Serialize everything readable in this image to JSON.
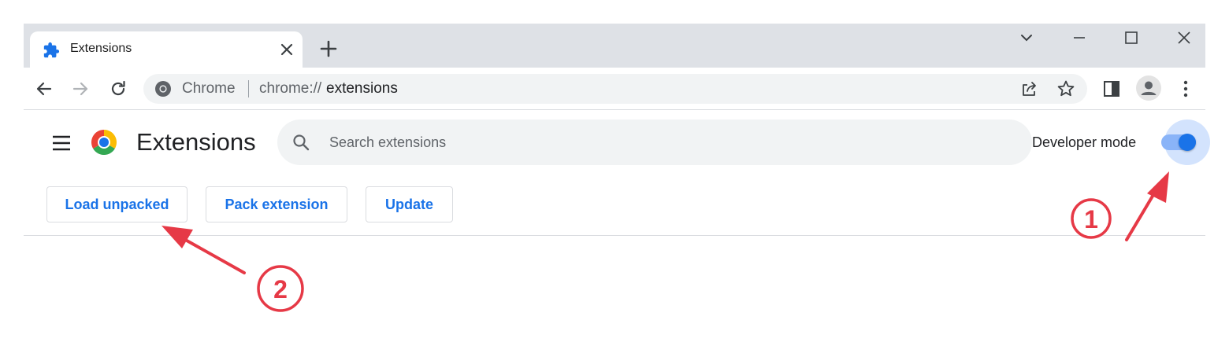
{
  "tab": {
    "title": "Extensions"
  },
  "omnibox": {
    "chip_label": "Chrome",
    "url_scheme": "chrome://",
    "url_path": "extensions"
  },
  "page": {
    "title": "Extensions",
    "search_placeholder": "Search extensions",
    "developer_mode_label": "Developer mode",
    "developer_mode_on": true
  },
  "actions": {
    "load_unpacked": "Load unpacked",
    "pack_extension": "Pack extension",
    "update": "Update"
  },
  "annotations": {
    "step1": "1",
    "step2": "2",
    "color": "#e63946"
  },
  "colors": {
    "accent": "#1a73e8",
    "tabstrip": "#dee1e6",
    "omnibox": "#f1f3f4"
  }
}
